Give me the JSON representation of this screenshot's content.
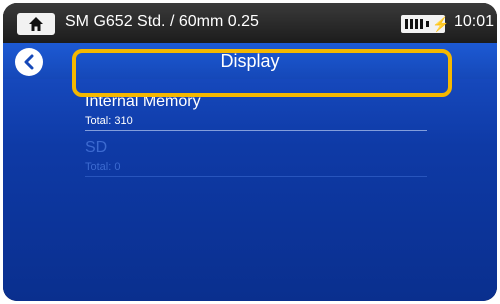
{
  "status": {
    "title": "SM G652 Std. / 60mm 0.25",
    "time": "10:01",
    "home_icon": "home-icon",
    "battery_icon": "battery-charging-icon"
  },
  "header": {
    "title": "Display",
    "back_icon": "back-arrow-icon"
  },
  "items": [
    {
      "name": "Internal Memory",
      "sub": "Total: 310",
      "enabled": true,
      "highlighted": true
    },
    {
      "name": "SD",
      "sub": "Total: 0",
      "enabled": false,
      "highlighted": false
    }
  ],
  "colors": {
    "highlight": "#f5b800",
    "background": "#0e3aa6"
  }
}
